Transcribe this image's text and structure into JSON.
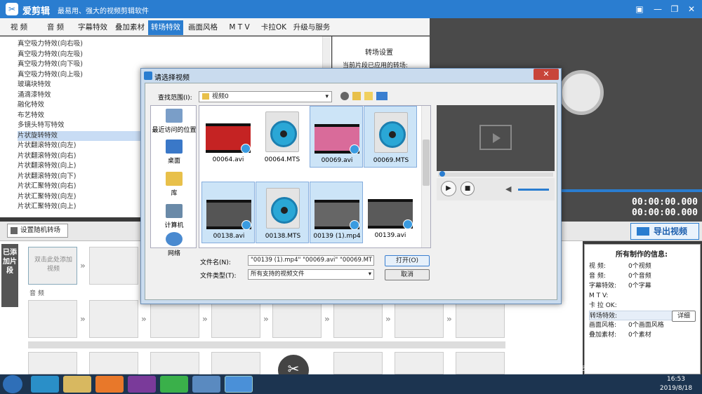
{
  "app": {
    "name": "爱剪辑",
    "slogan": "最易用、强大的视频剪辑软件",
    "accent_color": "#2a7dd0"
  },
  "tabs": [
    {
      "label": "视  频",
      "active": false
    },
    {
      "label": "音  频",
      "active": false
    },
    {
      "label": "字幕特效",
      "active": false
    },
    {
      "label": "叠加素材",
      "active": false
    },
    {
      "label": "转场特效",
      "active": true
    },
    {
      "label": "画面风格",
      "active": false
    },
    {
      "label": "M T V",
      "active": false
    },
    {
      "label": "卡拉OK",
      "active": false
    },
    {
      "label": "升级与服务",
      "active": false
    }
  ],
  "effects": [
    "真空吸力特效(向右吸)",
    "真空吸力特效(向左吸)",
    "真空吸力特效(向下吸)",
    "真空吸力特效(向上吸)",
    "玻璃块特效",
    "涌滴漆特效",
    "融化特效",
    "布艺特效",
    "多镜头特写特效",
    "片状旋转特效",
    "片状翻滚特效(向左)",
    "片状翻滚特效(向右)",
    "片状翻滚特效(向上)",
    "片状翻滚特效(向下)",
    "片状汇聚特效(向右)",
    "片状汇聚特效(向左)",
    "片状汇聚特效(向上)"
  ],
  "selected_effect_index": 9,
  "transition_settings": {
    "title": "转场设置",
    "current_label": "当前片段已应用的转场:"
  },
  "timecodes": [
    "00:00:00.000",
    "00:00:00.000"
  ],
  "random_transition_button": "设置随机转场",
  "export_button": "导出视频",
  "timeline": {
    "side_tab": "已添加片段",
    "add_clip_hint": "双击此处添加视频",
    "audio_label": "音  频"
  },
  "info_panel": {
    "title": "所有制作的信息:",
    "rows": [
      {
        "label": "视    频:",
        "value": "0个视频"
      },
      {
        "label": "音    频:",
        "value": "0个音频"
      },
      {
        "label": "字幕特效:",
        "value": "0个字幕"
      },
      {
        "label": "M  T  V:",
        "value": ""
      },
      {
        "label": "卡 拉 OK:",
        "value": ""
      },
      {
        "label": "转场特效:",
        "value": ""
      },
      {
        "label": "画面风格:",
        "value": "0个画面风格"
      },
      {
        "label": "叠加素材:",
        "value": "0个素材"
      }
    ],
    "detail_button": "详细"
  },
  "dialog": {
    "title": "请选择视频",
    "lookin_label": "查找范围(I):",
    "lookin_value": "视频0",
    "places": [
      "最近访问的位置",
      "桌面",
      "库",
      "计算机",
      "网络"
    ],
    "files": [
      {
        "name": "00064.avi",
        "kind": "video",
        "selected": false,
        "tone": "#c52323"
      },
      {
        "name": "00064.MTS",
        "kind": "mts",
        "selected": false
      },
      {
        "name": "00069.avi",
        "kind": "video",
        "selected": true,
        "tone": "#d96b9a"
      },
      {
        "name": "00069.MTS",
        "kind": "mts",
        "selected": true
      },
      {
        "name": "00138.avi",
        "kind": "video",
        "selected": true,
        "tone": "#555555"
      },
      {
        "name": "00138.MTS",
        "kind": "mts",
        "selected": true
      },
      {
        "name": "00139 (1).mp4",
        "kind": "video",
        "selected": true,
        "tone": "#666666"
      },
      {
        "name": "00139.avi",
        "kind": "video",
        "selected": false,
        "tone": "#5a5a5a"
      }
    ],
    "filename_label": "文件名(N):",
    "filename_value": "\"00139 (1).mp4\" \"00069.avi\" \"00069.MT",
    "filetype_label": "文件类型(T):",
    "filetype_value": "所有支持的视频文件",
    "open_button": "打开(O)",
    "cancel_button": "取消"
  },
  "watermark": {
    "text": "Bai du 经验",
    "url": "jingyan.baidu.com"
  },
  "clock": {
    "time": "16:53",
    "date": "2019/8/18"
  }
}
